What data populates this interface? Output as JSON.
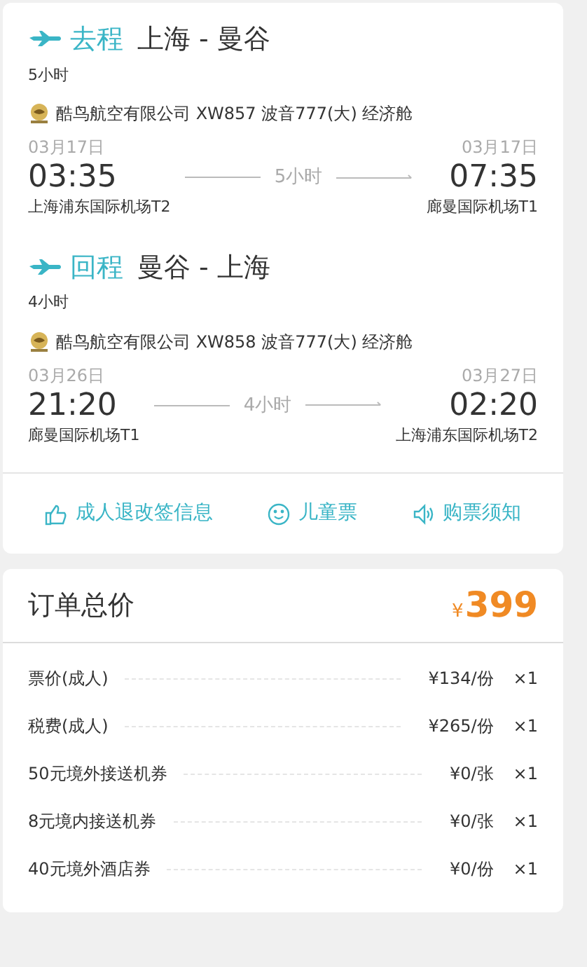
{
  "flights": [
    {
      "direction": "去程",
      "route": "上海 - 曼谷",
      "duration": "5小时",
      "airline": "酷鸟航空有限公司 XW857 波音777(大) 经济舱",
      "depart": {
        "date": "03月17日",
        "time": "03:35",
        "airport": "上海浦东国际机场T2"
      },
      "middle": "5小时",
      "arrive": {
        "date": "03月17日",
        "time": "07:35",
        "airport": "廊曼国际机场T1"
      }
    },
    {
      "direction": "回程",
      "route": "曼谷 - 上海",
      "duration": "4小时",
      "airline": "酷鸟航空有限公司 XW858 波音777(大) 经济舱",
      "depart": {
        "date": "03月26日",
        "time": "21:20",
        "airport": "廊曼国际机场T1"
      },
      "middle": "4小时",
      "arrive": {
        "date": "03月27日",
        "time": "02:20",
        "airport": "上海浦东国际机场T2"
      }
    }
  ],
  "links": [
    {
      "kind": "thumb",
      "label": "成人退改签信息"
    },
    {
      "kind": "smile",
      "label": "儿童票"
    },
    {
      "kind": "speaker",
      "label": "购票须知"
    }
  ],
  "order": {
    "title": "订单总价",
    "currency": "¥",
    "total": "399",
    "rows": [
      {
        "label": "票价(成人)",
        "price": "¥134/份",
        "qty": "×1"
      },
      {
        "label": "税费(成人)",
        "price": "¥265/份",
        "qty": "×1"
      },
      {
        "label": "50元境外接送机券",
        "price": "¥0/张",
        "qty": "×1"
      },
      {
        "label": "8元境内接送机券",
        "price": "¥0/张",
        "qty": "×1"
      },
      {
        "label": "40元境外酒店券",
        "price": "¥0/份",
        "qty": "×1"
      }
    ]
  }
}
